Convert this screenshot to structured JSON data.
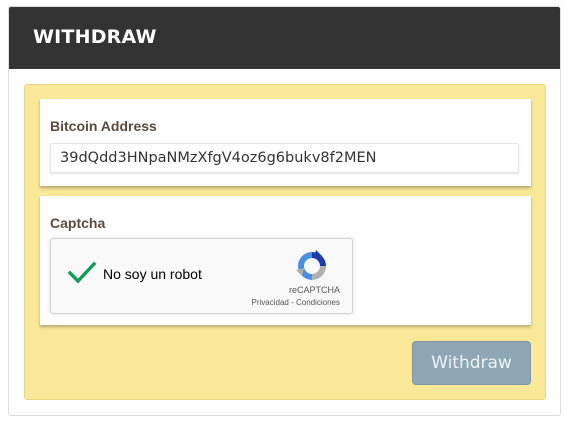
{
  "header": {
    "title": "WITHDRAW"
  },
  "form": {
    "address_label": "Bitcoin Address",
    "address_value": "39dQdd3HNpaNMzXfgV4oz6g6bukv8f2MEN",
    "captcha_label": "Captcha",
    "captcha": {
      "checkbox_label": "No soy un robot",
      "brand": "reCAPTCHA",
      "privacy_link": "Privacidad",
      "separator": " - ",
      "terms_link": "Condiciones",
      "checked": true
    },
    "submit_label": "Withdraw"
  },
  "colors": {
    "header_bg": "#333333",
    "panel_bg": "#f8e898",
    "button_bg": "#8fa7b5",
    "check": "#0f9d58"
  }
}
